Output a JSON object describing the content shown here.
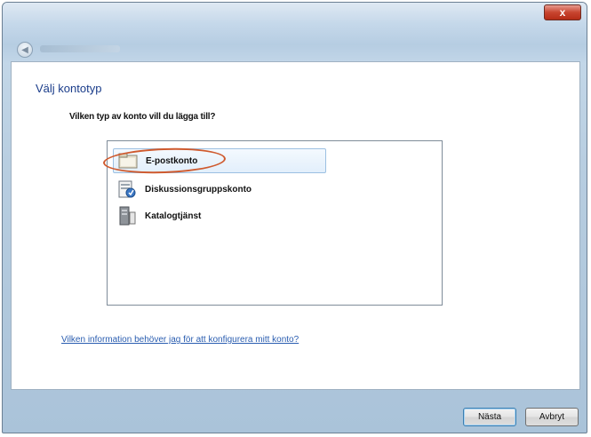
{
  "window": {
    "close_symbol": "x",
    "back_symbol": "◀"
  },
  "wizard": {
    "heading": "Välj kontotyp",
    "question": "Vilken typ av konto vill du lägga till?",
    "account_types": [
      {
        "label": "E-postkonto",
        "icon": "mail-folder-icon",
        "selected": true
      },
      {
        "label": "Diskussionsgruppskonto",
        "icon": "newsgroup-icon",
        "selected": false
      },
      {
        "label": "Katalogtjänst",
        "icon": "directory-server-icon",
        "selected": false
      }
    ],
    "help_link": "Vilken information behöver jag för att konfigurera mitt konto?"
  },
  "buttons": {
    "next": "Nästa",
    "cancel": "Avbryt"
  },
  "colors": {
    "accent_highlight": "#cf5a2e",
    "heading_blue": "#1a3c8a",
    "link_blue": "#2a5db0"
  }
}
